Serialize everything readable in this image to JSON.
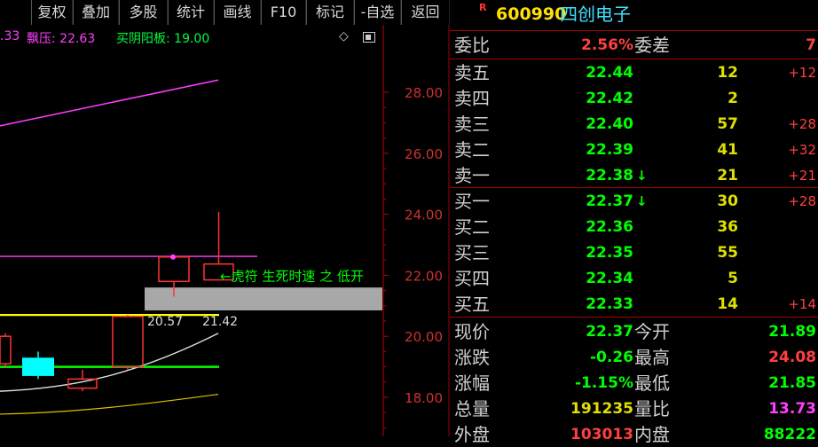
{
  "toolbar": {
    "buttons": [
      "复权",
      "叠加",
      "多股",
      "统计",
      "画线",
      "F10",
      "标记",
      "-自选",
      "返回"
    ]
  },
  "chart": {
    "indicators": [
      {
        "text": ".33",
        "color": "#ff40ff"
      },
      {
        "text": "飘压: 22.63",
        "color": "#ff40ff"
      },
      {
        "text": "买阴阳板: 19.00",
        "color": "#00ff40"
      }
    ],
    "y_ticks": [
      "28.00",
      "26.00",
      "24.00",
      "22.00",
      "20.00",
      "18.00"
    ],
    "annotation": "←虎符 生死时速 之 低开",
    "range_low_label": "20.57",
    "range_high_label": "21.42",
    "colors": {
      "up": "#ff3333",
      "down": "#00ffff",
      "axis": "#c00000",
      "magenta": "#ff40ff",
      "yellow": "#ffff00",
      "green": "#00ff00",
      "white": "#dddddd"
    }
  },
  "quote": {
    "badge": "R",
    "code": "600990",
    "name": "四创电子",
    "weibi_label": "委比",
    "weibi_value": "2.56%",
    "weicha_label": "委差",
    "weicha_value": "7",
    "asks": [
      {
        "label": "卖五",
        "price": "22.44",
        "vol": "12",
        "chg": "+12",
        "arrow": ""
      },
      {
        "label": "卖四",
        "price": "22.42",
        "vol": "2",
        "chg": "",
        "arrow": ""
      },
      {
        "label": "卖三",
        "price": "22.40",
        "vol": "57",
        "chg": "+28",
        "arrow": ""
      },
      {
        "label": "卖二",
        "price": "22.39",
        "vol": "41",
        "chg": "+32",
        "arrow": ""
      },
      {
        "label": "卖一",
        "price": "22.38",
        "vol": "21",
        "chg": "+21",
        "arrow": "↓"
      }
    ],
    "bids": [
      {
        "label": "买一",
        "price": "22.37",
        "vol": "30",
        "chg": "+28",
        "arrow": "↓"
      },
      {
        "label": "买二",
        "price": "22.36",
        "vol": "36",
        "chg": "",
        "arrow": ""
      },
      {
        "label": "买三",
        "price": "22.35",
        "vol": "55",
        "chg": "",
        "arrow": ""
      },
      {
        "label": "买四",
        "price": "22.34",
        "vol": "5",
        "chg": "",
        "arrow": ""
      },
      {
        "label": "买五",
        "price": "22.33",
        "vol": "14",
        "chg": "+14",
        "arrow": ""
      }
    ],
    "stats": [
      {
        "l1": "现价",
        "v1": "22.37",
        "c1": "#00ff00",
        "l2": "今开",
        "v2": "21.89",
        "c2": "#00ff00"
      },
      {
        "l1": "涨跌",
        "v1": "-0.26",
        "c1": "#00ff00",
        "l2": "最高",
        "v2": "24.08",
        "c2": "#ff4040"
      },
      {
        "l1": "涨幅",
        "v1": "-1.15%",
        "c1": "#00ff00",
        "l2": "最低",
        "v2": "21.85",
        "c2": "#00ff00"
      },
      {
        "l1": "总量",
        "v1": "191235",
        "c1": "#e0e000",
        "l2": "量比",
        "v2": "13.73",
        "c2": "#ff40ff"
      },
      {
        "l1": "外盘",
        "v1": "103013",
        "c1": "#ff4040",
        "l2": "内盘",
        "v2": "88222",
        "c2": "#00ff00"
      }
    ]
  }
}
